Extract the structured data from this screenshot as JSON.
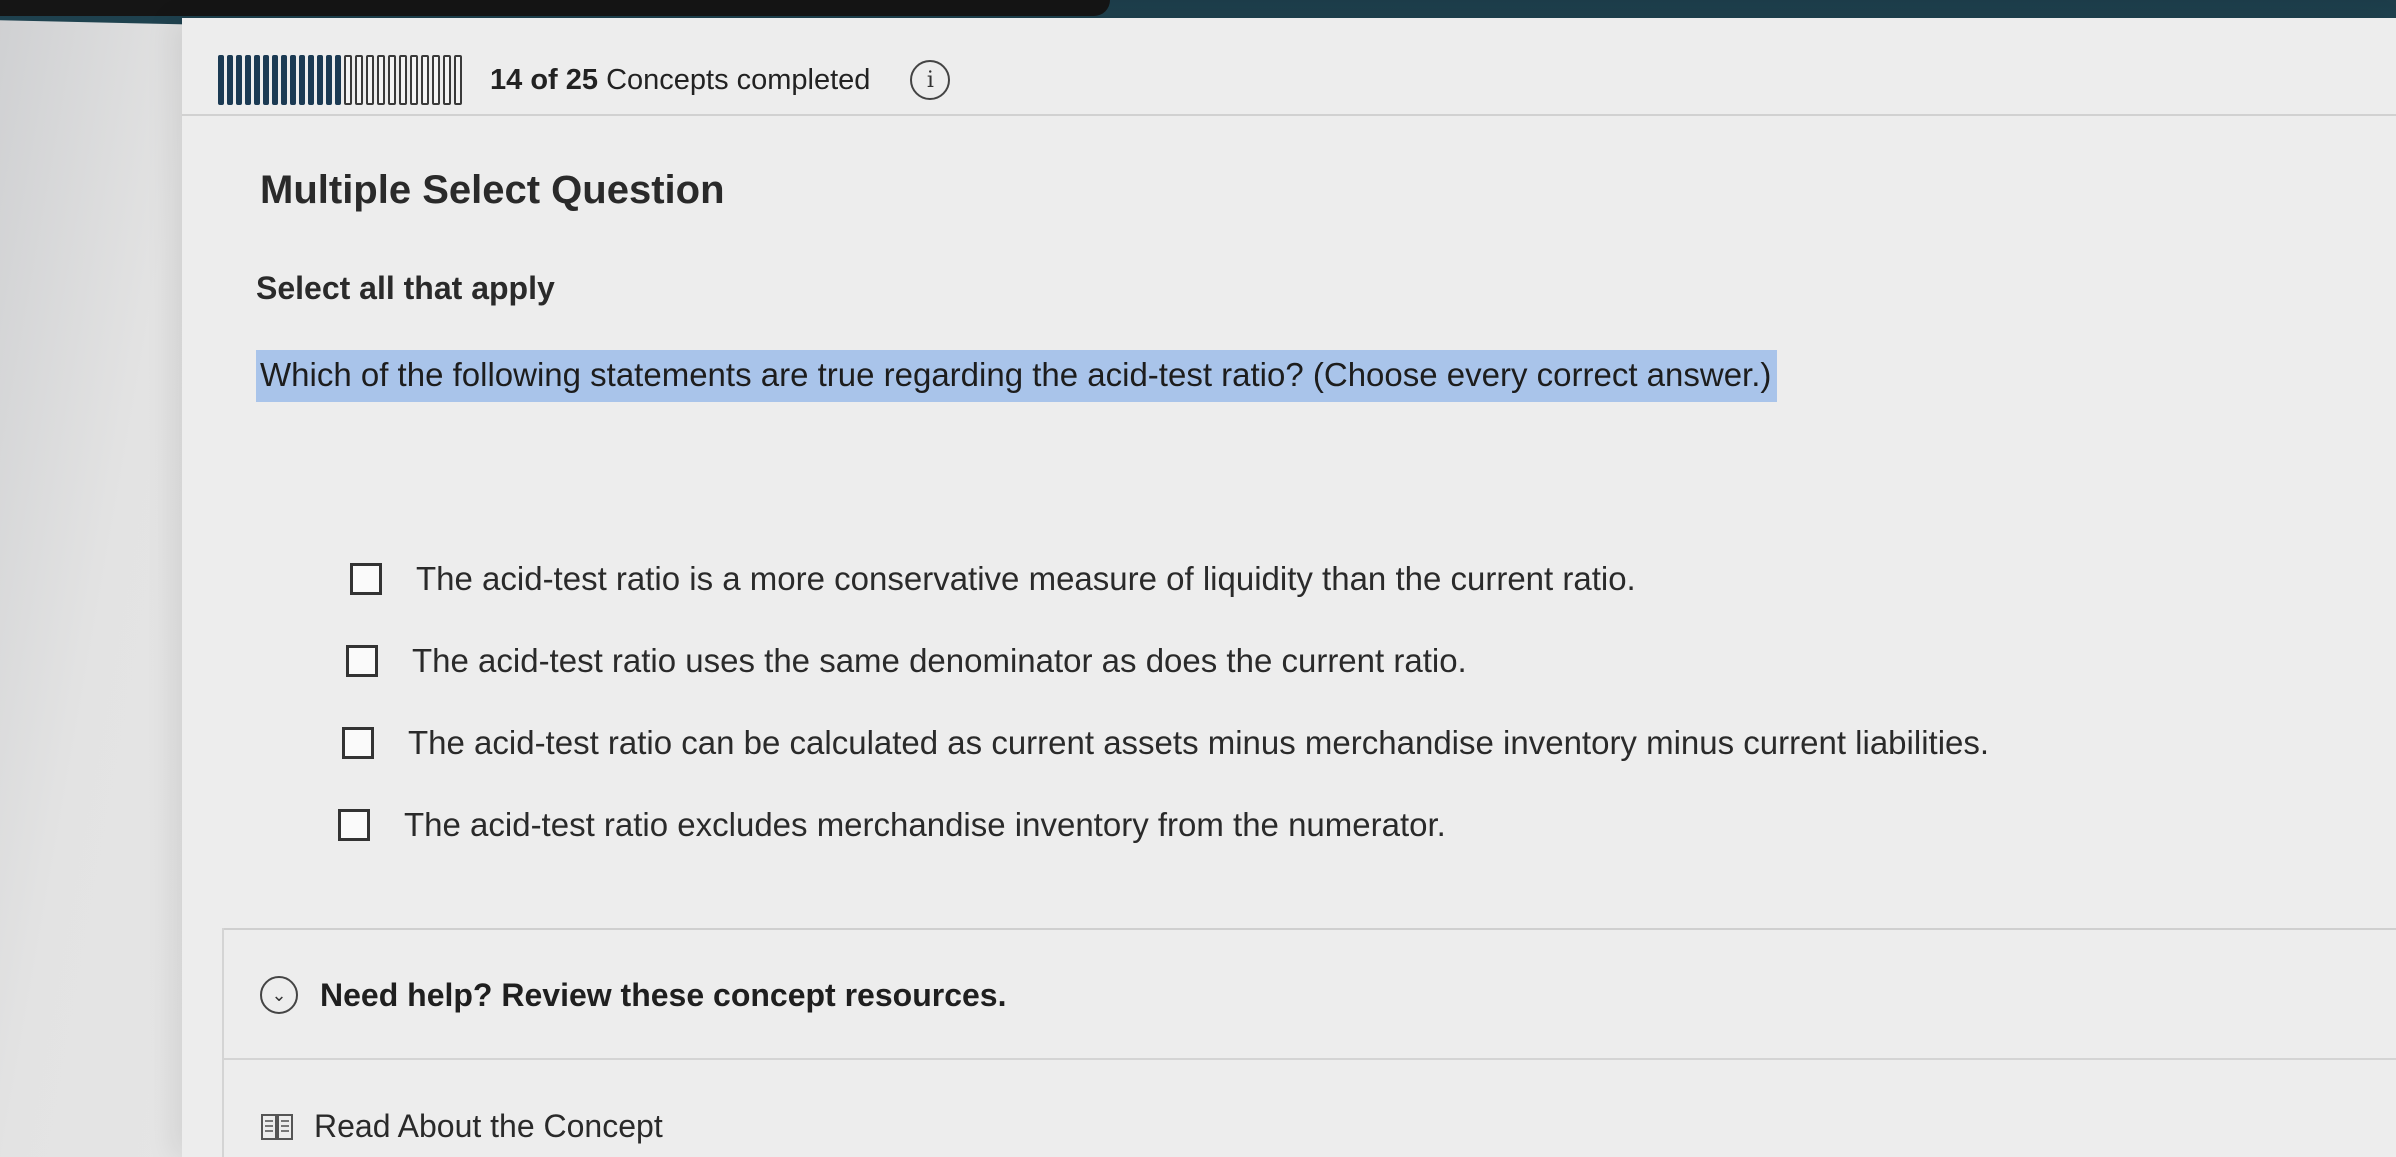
{
  "progress": {
    "completed": 14,
    "total": 25,
    "text_count": "14 of 25",
    "text_suffix": "Concepts completed",
    "info_glyph": "i"
  },
  "question_panel": {
    "title": "Multiple Select Question",
    "instruction": "Select all that apply",
    "question": "Which of the following statements are true regarding the acid-test ratio? (Choose every correct answer.)",
    "highlight_color": "#a9c4ea"
  },
  "options": [
    {
      "label": "The acid-test ratio is a more conservative measure of liquidity than the current ratio.",
      "checked": false
    },
    {
      "label": "The acid-test ratio uses the same denominator as does the current ratio.",
      "checked": false
    },
    {
      "label": "The acid-test ratio can be calculated as current assets minus merchandise inventory minus current liabilities.",
      "checked": false
    },
    {
      "label": "The acid-test ratio excludes merchandise inventory from the numerator.",
      "checked": false
    }
  ],
  "help": {
    "toggle_label": "Need help? Review these concept resources.",
    "chevron_glyph": "⌄",
    "resource_label": "Read About the Concept"
  },
  "colors": {
    "header_bar": "#23505d",
    "progress_fill": "#1b3a53"
  }
}
